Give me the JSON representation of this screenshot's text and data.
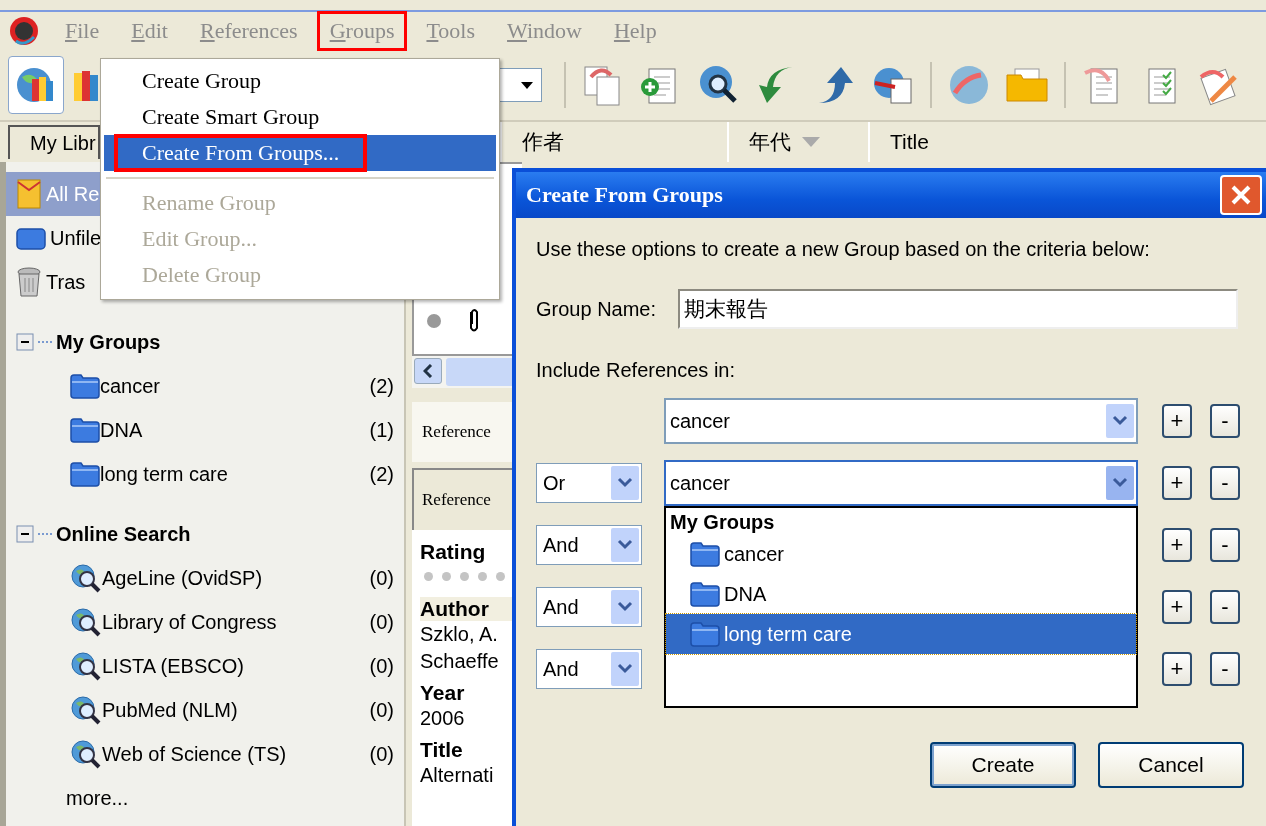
{
  "menu_bar": [
    {
      "label": "File",
      "selected": false
    },
    {
      "label": "Edit",
      "selected": false
    },
    {
      "label": "References",
      "selected": false
    },
    {
      "label": "Groups",
      "selected": true
    },
    {
      "label": "Tools",
      "selected": false
    },
    {
      "label": "Window",
      "selected": false
    },
    {
      "label": "Help",
      "selected": false
    }
  ],
  "library_tab": "My Libr",
  "columns": [
    {
      "label": "作者",
      "sorted": false
    },
    {
      "label": "年代",
      "sorted": true
    },
    {
      "label": "Title",
      "sorted": false
    }
  ],
  "sidebar": {
    "items": [
      {
        "label": "All Re",
        "kind": "library",
        "selected": true
      },
      {
        "label": "Unfile",
        "kind": "unfiled",
        "selected": false
      },
      {
        "label": "Tras",
        "kind": "trash",
        "selected": false
      }
    ],
    "sections": [
      {
        "title": "My Groups",
        "expanded": true,
        "kind": "group",
        "items": [
          {
            "label": "cancer",
            "count": "(2)"
          },
          {
            "label": "DNA",
            "count": "(1)"
          },
          {
            "label": "long term care",
            "count": "(2)"
          }
        ]
      },
      {
        "title": "Online Search",
        "expanded": true,
        "kind": "search",
        "items": [
          {
            "label": "AgeLine (OvidSP)",
            "count": "(0)"
          },
          {
            "label": "Library of Congress",
            "count": "(0)"
          },
          {
            "label": "LISTA (EBSCO)",
            "count": "(0)"
          },
          {
            "label": "PubMed (NLM)",
            "count": "(0)"
          },
          {
            "label": "Web of Science (TS)",
            "count": "(0)"
          }
        ]
      }
    ],
    "more": "more..."
  },
  "groups_menu": {
    "sections": [
      {
        "items": [
          {
            "label": "Create Group",
            "selected": false,
            "disabled": false
          },
          {
            "label": "Create Smart Group",
            "selected": false,
            "disabled": false
          },
          {
            "label": "Create From Groups...",
            "selected": true,
            "disabled": false
          }
        ]
      },
      {
        "items": [
          {
            "label": "Rename Group",
            "selected": false,
            "disabled": true
          },
          {
            "label": "Edit Group...",
            "selected": false,
            "disabled": true
          },
          {
            "label": "Delete Group",
            "selected": false,
            "disabled": true
          }
        ]
      }
    ]
  },
  "reference_panel": {
    "tab": "Reference",
    "header": "Reference",
    "fields": [
      {
        "label": "Rating",
        "kind": "rating",
        "stars": 0,
        "selected": false
      },
      {
        "label": "Author",
        "kind": "text",
        "lines": [
          "Szklo, A.",
          "Schaeffe"
        ],
        "selected": true
      },
      {
        "label": "Year",
        "kind": "text",
        "lines": [
          "2006"
        ],
        "selected": false
      },
      {
        "label": "Title",
        "kind": "text",
        "lines": [
          "Alternati"
        ],
        "selected": false
      }
    ]
  },
  "dialog": {
    "title": "Create From Groups",
    "intro": "Use these options to create a new Group based on the criteria below:",
    "group_name_label": "Group Name:",
    "group_name_value": "期末報告",
    "include_label": "Include References in:",
    "criteria": [
      {
        "group": "cancer",
        "expanded": false,
        "add": "+",
        "remove": "-"
      },
      {
        "operator": "Or",
        "group": "cancer",
        "expanded": true,
        "add": "+",
        "remove": "-"
      },
      {
        "operator": "And",
        "add": "+",
        "remove": "-"
      },
      {
        "operator": "And",
        "add": "+",
        "remove": "-"
      },
      {
        "operator": "And",
        "add": "+",
        "remove": "-"
      }
    ],
    "group_list": {
      "heading": "My Groups",
      "items": [
        {
          "label": "cancer",
          "selected": false
        },
        {
          "label": "DNA",
          "selected": false
        },
        {
          "label": "long term care",
          "selected": true
        }
      ]
    },
    "buttons": [
      {
        "label": "Create",
        "default": true
      },
      {
        "label": "Cancel",
        "default": false
      }
    ]
  }
}
